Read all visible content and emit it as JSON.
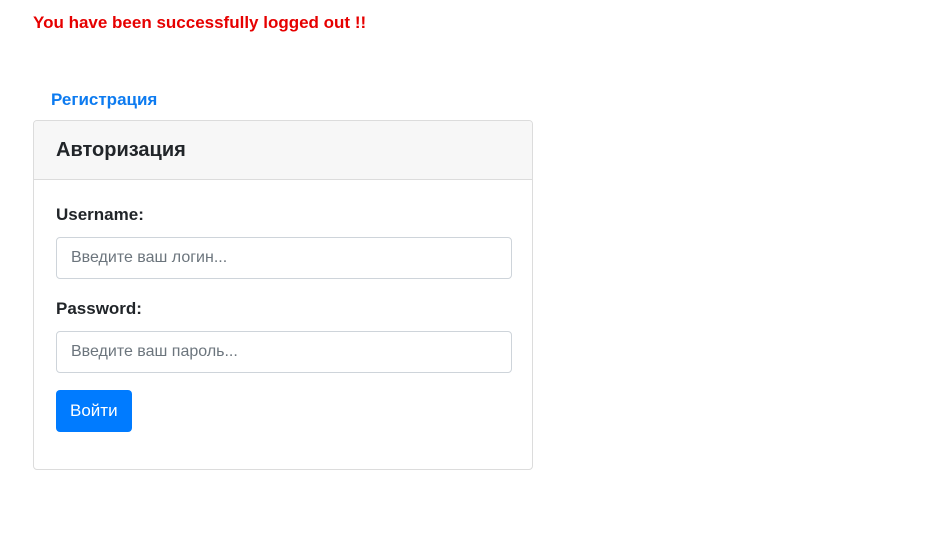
{
  "message": {
    "logout_text": "You have been successfully logged out !!",
    "color": "#e60000"
  },
  "nav": {
    "register_label": "Регистрация",
    "link_color": "#0d7bf0"
  },
  "login_card": {
    "title": "Авторизация",
    "username_label": "Username:",
    "username_placeholder": "Введите ваш логин...",
    "username_value": "",
    "password_label": "Password:",
    "password_placeholder": "Введите ваш пароль...",
    "password_value": "",
    "submit_label": "Войти",
    "button_color": "#007bff"
  }
}
